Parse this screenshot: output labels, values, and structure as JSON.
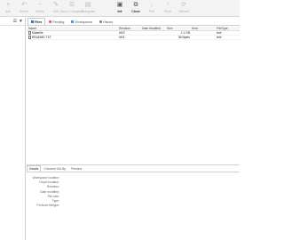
{
  "toolbar": {
    "buttons": [
      {
        "label": "Add",
        "icon": "+",
        "active": false
      },
      {
        "label": "Revert",
        "icon": "↶",
        "active": false
      },
      {
        "label": "Delete",
        "icon": "−",
        "active": false
      },
      {
        "label": "Edit",
        "icon": "✎",
        "active": false
      },
      {
        "label": "Add to Changelist",
        "icon": "☰",
        "active": false
      },
      {
        "label": "Changelist",
        "icon": "▤",
        "active": false
      },
      {
        "label": "",
        "icon": "",
        "active": false
      },
      {
        "label": "Init",
        "icon": "▣",
        "active": true
      },
      {
        "label": "Clone",
        "icon": "⧉",
        "active": true
      },
      {
        "label": "Pull",
        "icon": "↓",
        "active": false
      },
      {
        "label": "Push",
        "icon": "↑",
        "active": false
      },
      {
        "label": "Refresh",
        "icon": "⟳",
        "active": false
      }
    ]
  },
  "left_pane": {
    "tools": [
      "☰",
      "▼"
    ]
  },
  "tabs": [
    {
      "label": "Files",
      "active": true,
      "color": "#3a6fb0"
    },
    {
      "label": "Pending",
      "active": false,
      "color": "#d9534f"
    },
    {
      "label": "Workspaces",
      "active": false,
      "color": "#5b8fc7"
    },
    {
      "label": "History",
      "active": false,
      "color": "#7a7a7a"
    }
  ],
  "table": {
    "headers": {
      "name": "Name",
      "revision": "Revision",
      "date_modified": "Date Modified",
      "size": "Size",
      "kind": "Kind",
      "file_type": "FileType"
    },
    "rows": [
      {
        "name": "Makefile",
        "revision": "#0/2",
        "date_modified": "",
        "size": "1.1 KB",
        "kind": "",
        "file_type": "text"
      },
      {
        "name": "README.TXT",
        "revision": "#0/1",
        "date_modified": "",
        "size": "36 Bytes",
        "kind": "",
        "file_type": "text"
      }
    ]
  },
  "details": {
    "tabs": [
      {
        "label": "Details",
        "active": true
      },
      {
        "label": "Checked Out By",
        "active": false
      },
      {
        "label": "Preview",
        "active": false
      }
    ],
    "properties": [
      "Workspace location:",
      "Depot location:",
      "Revision:",
      "Date modified:",
      "File size:",
      "Type:",
      "Perforce filetype:"
    ]
  }
}
